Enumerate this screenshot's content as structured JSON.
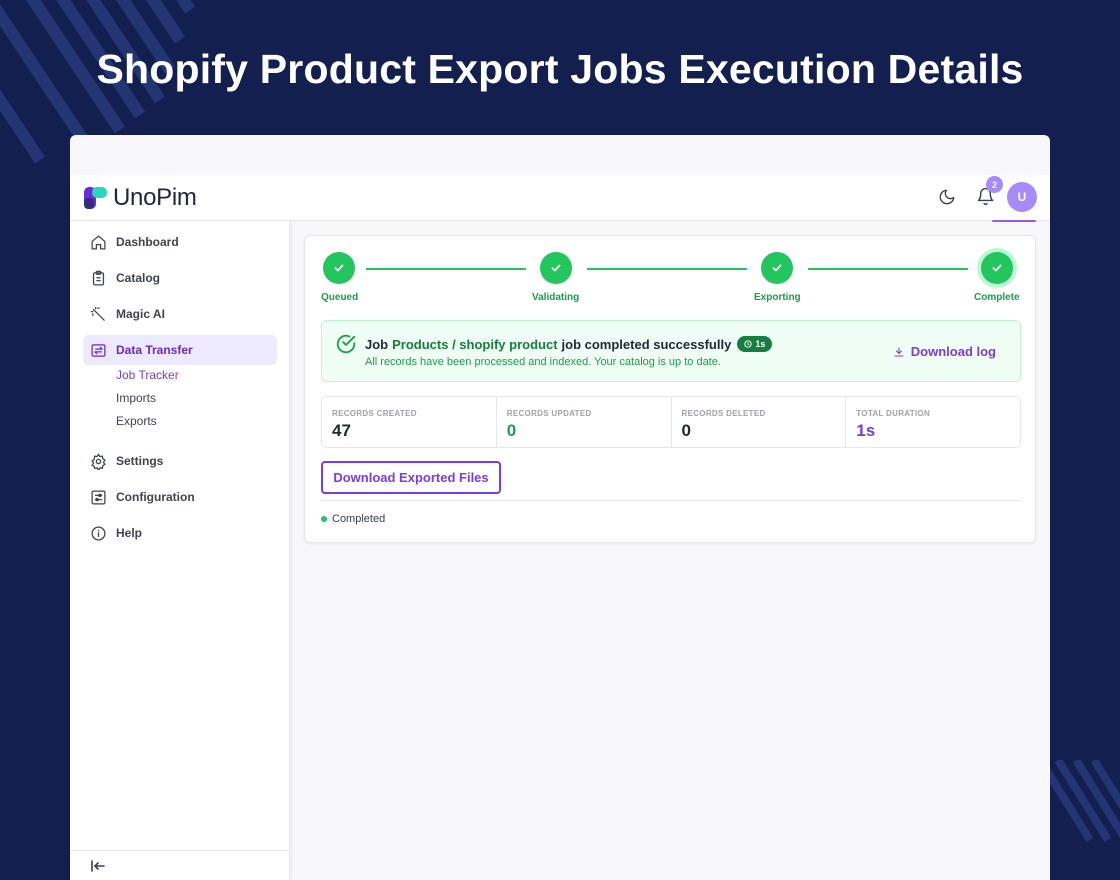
{
  "heading": "Shopify Product Export Jobs Execution Details",
  "app": {
    "name": "UnoPim",
    "notification_count": "2",
    "avatar_initial": "U"
  },
  "colors": {
    "accent": "#7c3aed",
    "success": "#22c55e",
    "background": "#13204f"
  },
  "sidebar": {
    "items": [
      {
        "label": "Dashboard",
        "icon": "home-icon"
      },
      {
        "label": "Catalog",
        "icon": "clipboard-icon"
      },
      {
        "label": "Magic AI",
        "icon": "magic-wand-icon"
      },
      {
        "label": "Data Transfer",
        "icon": "transfer-icon",
        "active": true
      },
      {
        "label": "Settings",
        "icon": "gear-icon"
      },
      {
        "label": "Configuration",
        "icon": "sliders-icon"
      },
      {
        "label": "Help",
        "icon": "info-icon"
      }
    ],
    "sub_items": [
      {
        "label": "Job Tracker",
        "active": true
      },
      {
        "label": "Imports"
      },
      {
        "label": "Exports"
      }
    ]
  },
  "steps": [
    "Queued",
    "Validating",
    "Exporting",
    "Complete"
  ],
  "banner": {
    "prefix": "Job",
    "job_link": "Products / shopify product",
    "suffix": "job completed successfully",
    "duration": "1s",
    "subtitle": "All records have been processed and indexed. Your catalog is up to date.",
    "download_log": "Download log"
  },
  "stats": [
    {
      "label": "RECORDS CREATED",
      "value": "47",
      "color": "#1f2937"
    },
    {
      "label": "RECORDS UPDATED",
      "value": "0",
      "color": "#16a34a"
    },
    {
      "label": "RECORDS DELETED",
      "value": "0",
      "color": "#1f2937"
    },
    {
      "label": "TOTAL DURATION",
      "value": "1s",
      "color": "#7c3aed"
    }
  ],
  "download_files": "Download Exported Files",
  "status": "Completed"
}
